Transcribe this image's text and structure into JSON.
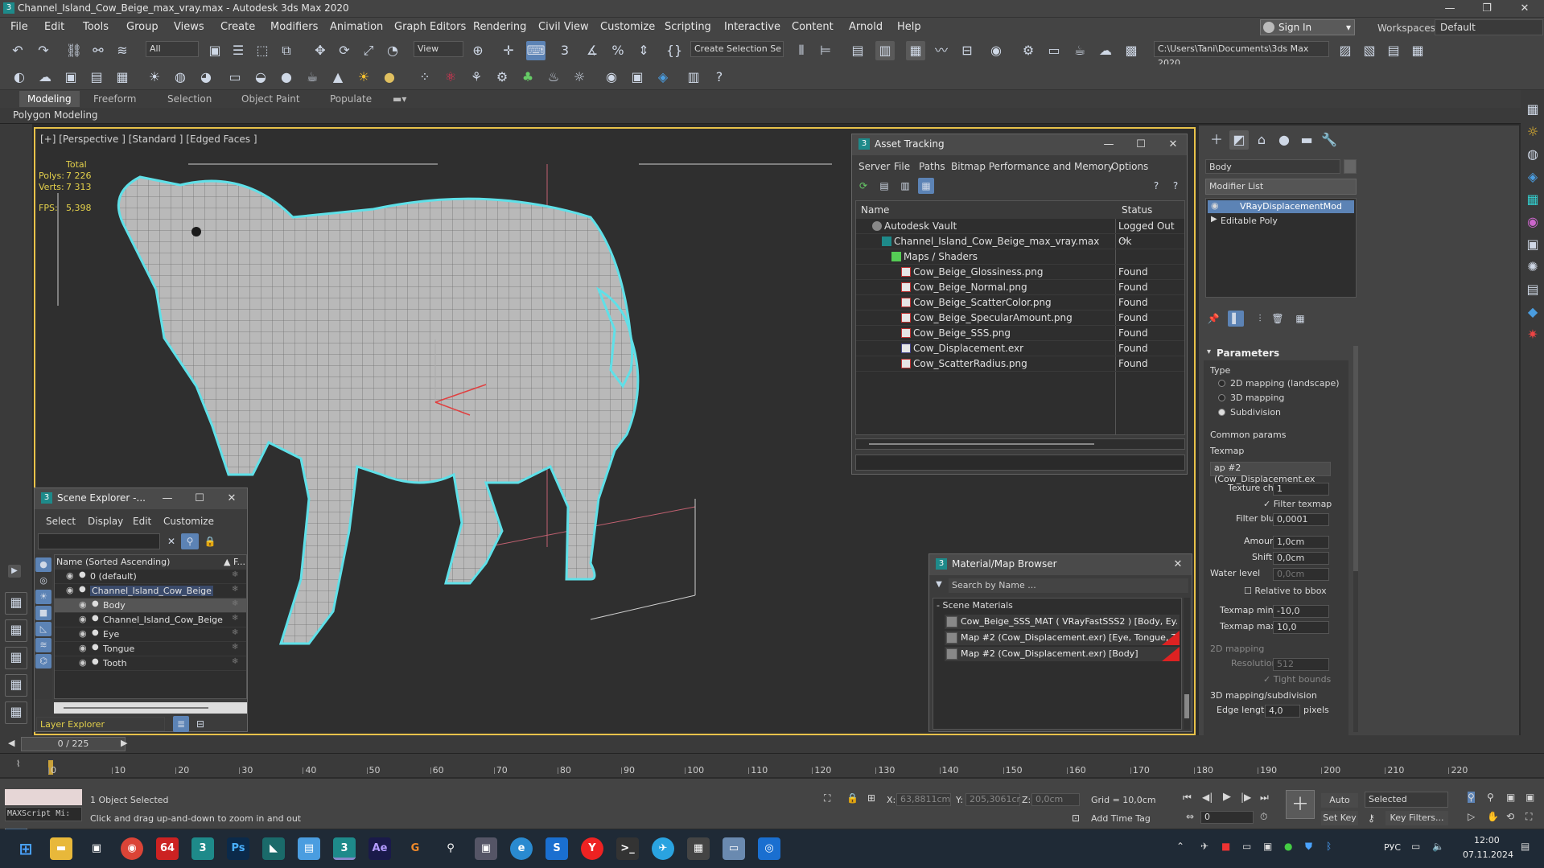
{
  "title": "Channel_Island_Cow_Beige_max_vray.max - Autodesk 3ds Max 2020",
  "menu": [
    "File",
    "Edit",
    "Tools",
    "Group",
    "Views",
    "Create",
    "Modifiers",
    "Animation",
    "Graph Editors",
    "Rendering",
    "Civil View",
    "Customize",
    "Scripting",
    "Interactive",
    "Content",
    "Arnold",
    "Help"
  ],
  "signin": "Sign In",
  "workspaces_label": "Workspaces:",
  "workspace": "Default",
  "toolbar": {
    "filter": "All",
    "view": "View",
    "selection_set": "Create Selection Se",
    "path": "C:\\Users\\Tani\\Documents\\3ds Max 2020"
  },
  "ribbon": {
    "tabs": [
      "Modeling",
      "Freeform",
      "Selection",
      "Object Paint",
      "Populate"
    ],
    "sub": "Polygon Modeling"
  },
  "viewport": {
    "label": "[+] [Perspective ] [Standard ] [Edged Faces ]",
    "total": "Total",
    "polys_label": "Polys:",
    "polys": "7 226",
    "verts_label": "Verts:",
    "verts": "7 313",
    "fps_label": "FPS:",
    "fps": "5,398"
  },
  "asset_tracking": {
    "title": "Asset Tracking",
    "menu": [
      "Server",
      "File",
      "Paths",
      "Bitmap Performance and Memory",
      "Options"
    ],
    "col_name": "Name",
    "col_status": "Status",
    "rows": [
      {
        "name": "Autodesk Vault",
        "status": "Logged Out ...",
        "indent": 1,
        "icon": "vault"
      },
      {
        "name": "Channel_Island_Cow_Beige_max_vray.max",
        "status": "Ok",
        "indent": 2,
        "icon": "max"
      },
      {
        "name": "Maps / Shaders",
        "status": "",
        "indent": 3,
        "icon": "maps"
      },
      {
        "name": "Cow_Beige_Glossiness.png",
        "status": "Found",
        "indent": 4,
        "icon": "png"
      },
      {
        "name": "Cow_Beige_Normal.png",
        "status": "Found",
        "indent": 4,
        "icon": "png"
      },
      {
        "name": "Cow_Beige_ScatterColor.png",
        "status": "Found",
        "indent": 4,
        "icon": "png"
      },
      {
        "name": "Cow_Beige_SpecularAmount.png",
        "status": "Found",
        "indent": 4,
        "icon": "png"
      },
      {
        "name": "Cow_Beige_SSS.png",
        "status": "Found",
        "indent": 4,
        "icon": "png"
      },
      {
        "name": "Cow_Displacement.exr",
        "status": "Found",
        "indent": 4,
        "icon": "exr"
      },
      {
        "name": "Cow_ScatterRadius.png",
        "status": "Found",
        "indent": 4,
        "icon": "png"
      }
    ]
  },
  "scene_explorer": {
    "title": "Scene Explorer -...",
    "menu": [
      "Select",
      "Display",
      "Edit",
      "Customize"
    ],
    "col": "Name (Sorted Ascending)",
    "col2": "▲ F...",
    "rows": [
      {
        "name": "0 (default)",
        "indent": 0
      },
      {
        "name": "Channel_Island_Cow_Beige",
        "indent": 0
      },
      {
        "name": "Body",
        "indent": 1
      },
      {
        "name": "Channel_Island_Cow_Beige",
        "indent": 1
      },
      {
        "name": "Eye",
        "indent": 1
      },
      {
        "name": "Tongue",
        "indent": 1
      },
      {
        "name": "Tooth",
        "indent": 1
      }
    ],
    "footer": "Layer Explorer"
  },
  "material_browser": {
    "title": "Material/Map Browser",
    "search": "Search by Name ...",
    "group": "- Scene Materials",
    "items": [
      "Cow_Beige_SSS_MAT  ( VRayFastSSS2 ) [Body, Ey...",
      "Map #2 (Cow_Displacement.exr)  [Eye, Tongue, To...",
      "Map #2 (Cow_Displacement.exr)  [Body]"
    ]
  },
  "modifier": {
    "object_name": "Body",
    "list_label": "Modifier List",
    "stack": [
      "VRayDisplacementMod",
      "Editable Poly"
    ],
    "parameters": "Parameters",
    "type_label": "Type",
    "types": [
      "2D mapping (landscape)",
      "3D mapping",
      "Subdivision"
    ],
    "common": "Common params",
    "texmap_label": "Texmap",
    "texmap": "ap #2 (Cow_Displacement.ex",
    "texture_chan_label": "Texture chan",
    "texture_chan": "1",
    "filter_texmap": "Filter texmap",
    "filter_blur_label": "Filter blur",
    "filter_blur": "0,0001",
    "amount_label": "Amount",
    "amount": "1,0cm",
    "shift_label": "Shift",
    "shift": "0,0cm",
    "water_label": "Water level",
    "water": "0,0cm",
    "relative": "Relative to bbox",
    "texmap_min_label": "Texmap min",
    "texmap_min": "-10,0",
    "texmap_max_label": "Texmap max",
    "texmap_max": "10,0",
    "mapping2d": "2D mapping",
    "resolution_label": "Resolution",
    "resolution": "512",
    "tight": "Tight bounds",
    "mapping3d": "3D mapping/subdivision",
    "edge_label": "Edge length",
    "edge": "4,0",
    "pixels": "pixels"
  },
  "timeline": {
    "frame": "0 / 225",
    "ticks": [
      0,
      10,
      20,
      30,
      40,
      50,
      60,
      70,
      80,
      90,
      100,
      110,
      120,
      130,
      140,
      150,
      160,
      170,
      180,
      190,
      200,
      210,
      220
    ]
  },
  "status": {
    "maxscript": "MAXScript Mi:",
    "selected": "1 Object Selected",
    "hint": "Click and drag up-and-down to zoom in and out",
    "x_label": "X:",
    "x": "63,8811cm",
    "y_label": "Y:",
    "y": "205,3061cr",
    "z_label": "Z:",
    "z": "0,0cm",
    "grid": "Grid = 10,0cm",
    "add_time_tag": "Add Time Tag",
    "auto_key": "Auto Key",
    "set_key": "Set Key",
    "selected_dd": "Selected",
    "key_filters": "Key Filters...",
    "frame_field": "0"
  },
  "taskbar": {
    "lang": "РУС",
    "time": "12:00",
    "date": "07.11.2024",
    "badge": "64"
  }
}
